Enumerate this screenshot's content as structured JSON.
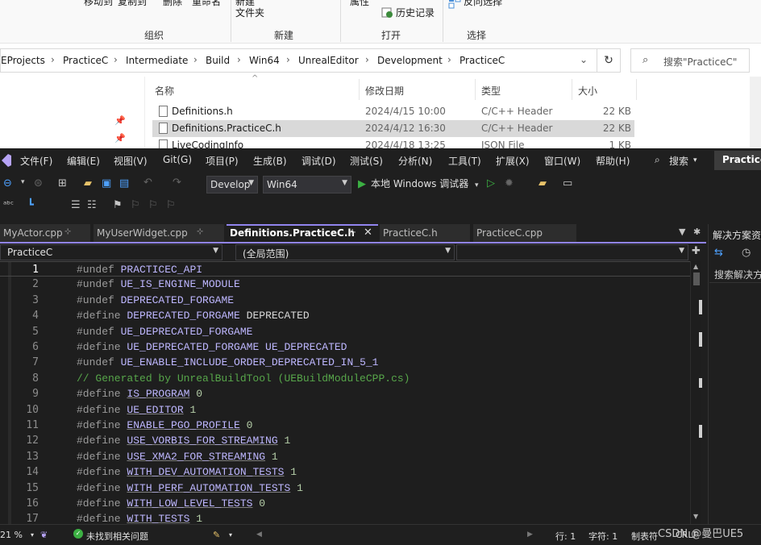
{
  "explorer": {
    "ribbon": {
      "top_texts": [
        "移动到",
        "复制到",
        "删除",
        "重命名",
        "新建",
        "属性",
        "反向选择"
      ],
      "new_folder": [
        "新建",
        "文件夹"
      ],
      "history": "历史记录",
      "groups": [
        "组织",
        "新建",
        "打开",
        "选择"
      ]
    },
    "breadcrumb": [
      "EProjects",
      "PracticeC",
      "Intermediate",
      "Build",
      "Win64",
      "UnrealEditor",
      "Development",
      "PracticeC"
    ],
    "search_placeholder": "搜索\"PracticeC\"",
    "columns": {
      "name": "名称",
      "date": "修改日期",
      "type": "类型",
      "size": "大小"
    },
    "files": [
      {
        "name": "Definitions.h",
        "date": "2024/4/15 10:00",
        "type": "C/C++ Header",
        "size": "22 KB"
      },
      {
        "name": "Definitions.PracticeC.h",
        "date": "2024/4/12 16:30",
        "type": "C/C++ Header",
        "size": "22 KB"
      },
      {
        "name": "LiveCodingInfo",
        "date": "2024/4/18 13:25",
        "type": "JSON File",
        "size": "1 KB"
      }
    ]
  },
  "vs": {
    "menu": [
      "文件(F)",
      "编辑(E)",
      "视图(V)",
      "Git(G)",
      "项目(P)",
      "生成(B)",
      "调试(D)",
      "测试(S)",
      "分析(N)",
      "工具(T)",
      "扩展(X)",
      "窗口(W)",
      "帮助(H)"
    ],
    "search": "搜索",
    "title": "Practice",
    "config_combo": "Develop",
    "platform_combo": "Win64",
    "run_label": "本地 Windows 调试器",
    "tabs": [
      {
        "label": "MyActor.cpp",
        "active": false
      },
      {
        "label": "MyUserWidget.cpp",
        "active": false
      },
      {
        "label": "Definitions.PracticeC.h",
        "active": true
      },
      {
        "label": "PracticeC.h",
        "active": false
      },
      {
        "label": "PracticeC.cpp",
        "active": false
      }
    ],
    "nav_project": "PracticeC",
    "nav_scope": "(全局范围)",
    "solution_panel": {
      "title": "解决方案资",
      "search": "搜索解决方"
    },
    "code_lines": [
      {
        "n": "1",
        "kw": "#undef",
        "rest": [
          [
            "mac",
            "PRACTICEC_API"
          ]
        ]
      },
      {
        "n": "2",
        "kw": "#undef",
        "rest": [
          [
            "mac",
            "UE_IS_ENGINE_MODULE"
          ]
        ]
      },
      {
        "n": "3",
        "kw": "#undef",
        "rest": [
          [
            "mac",
            "DEPRECATED_FORGAME"
          ]
        ]
      },
      {
        "n": "4",
        "kw": "#define",
        "rest": [
          [
            "mac",
            "DEPRECATED_FORGAME"
          ],
          [
            "id",
            " DEPRECATED"
          ]
        ]
      },
      {
        "n": "5",
        "kw": "#undef",
        "rest": [
          [
            "mac",
            "UE_DEPRECATED_FORGAME"
          ]
        ]
      },
      {
        "n": "6",
        "kw": "#define",
        "rest": [
          [
            "mac",
            "UE_DEPRECATED_FORGAME"
          ],
          [
            "mac",
            " UE_DEPRECATED"
          ]
        ]
      },
      {
        "n": "7",
        "kw": "#undef",
        "rest": [
          [
            "mac",
            "UE_ENABLE_INCLUDE_ORDER_DEPRECATED_IN_5_1"
          ]
        ]
      },
      {
        "n": "8",
        "kw": "",
        "rest": [
          [
            "cmt",
            "// Generated by UnrealBuildTool (UEBuildModuleCPP.cs)"
          ]
        ]
      },
      {
        "n": "9",
        "kw": "#define",
        "rest": [
          [
            "mac-u",
            "IS_PROGRAM"
          ],
          [
            "num",
            " 0"
          ]
        ]
      },
      {
        "n": "10",
        "kw": "#define",
        "rest": [
          [
            "mac-u",
            "UE_EDITOR"
          ],
          [
            "num",
            " 1"
          ]
        ]
      },
      {
        "n": "11",
        "kw": "#define",
        "rest": [
          [
            "mac-u",
            "ENABLE_PGO_PROFILE"
          ],
          [
            "num",
            " 0"
          ]
        ]
      },
      {
        "n": "12",
        "kw": "#define",
        "rest": [
          [
            "mac-u",
            "USE_VORBIS_FOR_STREAMING"
          ],
          [
            "num",
            " 1"
          ]
        ]
      },
      {
        "n": "13",
        "kw": "#define",
        "rest": [
          [
            "mac-u",
            "USE_XMA2_FOR_STREAMING"
          ],
          [
            "num",
            " 1"
          ]
        ]
      },
      {
        "n": "14",
        "kw": "#define",
        "rest": [
          [
            "mac-u",
            "WITH_DEV_AUTOMATION_TESTS"
          ],
          [
            "num",
            " 1"
          ]
        ]
      },
      {
        "n": "15",
        "kw": "#define",
        "rest": [
          [
            "mac-u",
            "WITH_PERF_AUTOMATION_TESTS"
          ],
          [
            "num",
            " 1"
          ]
        ]
      },
      {
        "n": "16",
        "kw": "#define",
        "rest": [
          [
            "mac-u",
            "WITH_LOW_LEVEL_TESTS"
          ],
          [
            "num",
            " 0"
          ]
        ]
      },
      {
        "n": "17",
        "kw": "#define",
        "rest": [
          [
            "mac-u",
            "WITH_TESTS"
          ],
          [
            "num",
            " 1"
          ]
        ]
      }
    ],
    "status": {
      "zoom": "21 %",
      "issues": "未找到相关问题",
      "line": "行: 1",
      "char": "字符: 1",
      "tabs": "制表符",
      "eol": "CRLF"
    }
  },
  "watermark": "CSDN @曼巴UE5"
}
